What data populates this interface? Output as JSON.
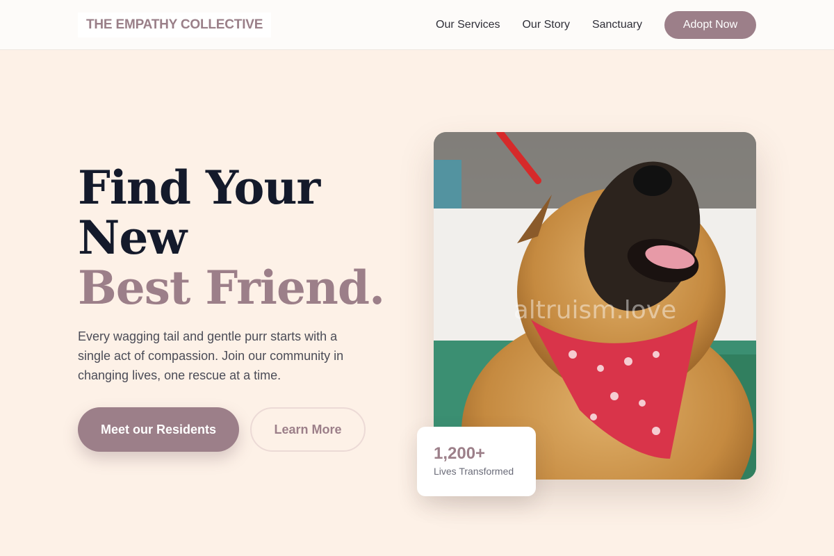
{
  "brand": {
    "name": "THE EMPATHY COLLECTIVE"
  },
  "nav": {
    "links": [
      "Our Services",
      "Our Story",
      "Sanctuary"
    ],
    "cta": "Adopt Now"
  },
  "hero": {
    "headline_line1": "Find Your",
    "headline_line2": "New",
    "headline_accent": "Best Friend.",
    "lead": "Every wagging tail and gentle purr starts with a single act of compassion. Join our community in changing lives, one rescue at a time.",
    "primary_button": "Meet our Residents",
    "secondary_button": "Learn More"
  },
  "photo": {
    "watermark": "altruism.love"
  },
  "stat": {
    "value": "1,200+",
    "label": "Lives Transformed"
  },
  "colors": {
    "accent": "#9c7f89",
    "background": "#fdf1e7",
    "heading": "#141a2b"
  }
}
